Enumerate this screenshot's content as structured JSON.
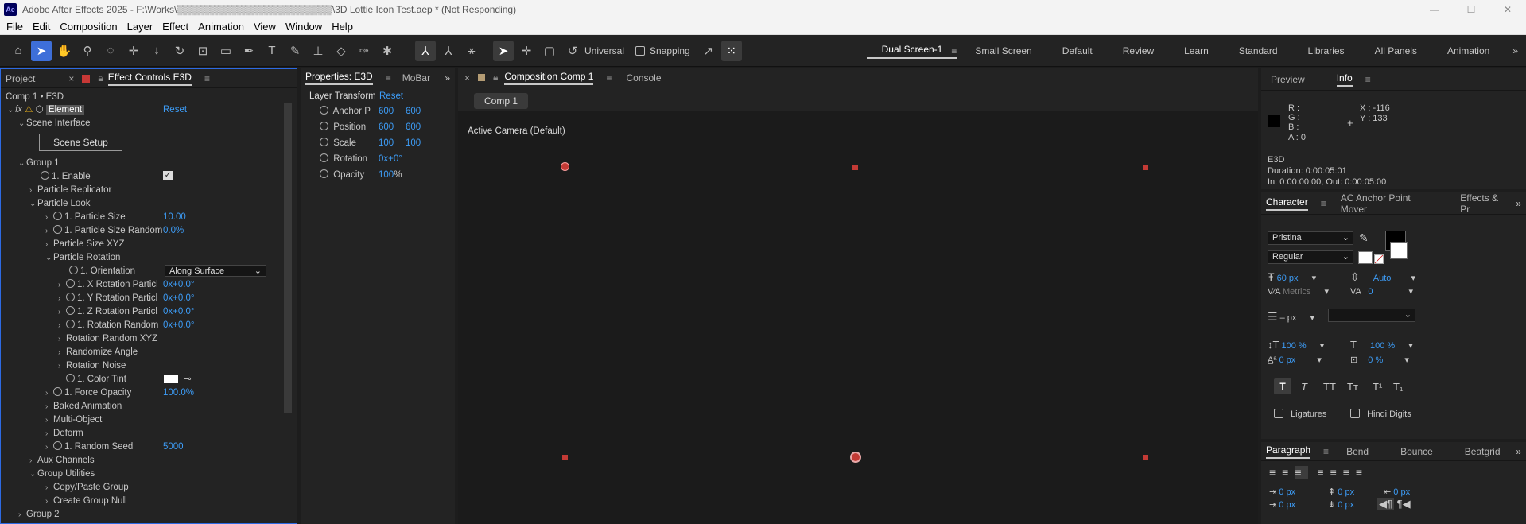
{
  "window": {
    "title": "Adobe After Effects 2025 - F:\\Works\\▒▒▒▒▒▒▒▒▒▒▒▒▒▒▒▒▒▒▒▒▒▒▒\\3D Lottie Icon Test.aep * (Not Responding)",
    "app_icon": "Ae"
  },
  "menu": [
    "File",
    "Edit",
    "Composition",
    "Layer",
    "Effect",
    "Animation",
    "View",
    "Window",
    "Help"
  ],
  "toolbar": {
    "universal": "Universal",
    "snapping": "Snapping"
  },
  "workspaces": [
    "Dual Screen-1",
    "Small Screen",
    "Default",
    "Review",
    "Learn",
    "Standard",
    "Libraries",
    "All Panels",
    "Animation"
  ],
  "left_panel": {
    "tab_project": "Project",
    "tab_effects": "Effect Controls E3D",
    "header": "Comp 1 • E3D",
    "fx": "fx",
    "element": "Element",
    "reset": "Reset",
    "scene_interface": "Scene Interface",
    "scene_setup": "Scene Setup",
    "group1": "Group 1",
    "enable": "1. Enable",
    "particle_replicator": "Particle Replicator",
    "particle_look": "Particle Look",
    "particle_size": "1. Particle Size",
    "particle_size_val": "10.00",
    "particle_size_random": "1. Particle Size Random",
    "particle_size_random_val": "0.0%",
    "particle_size_xyz": "Particle Size XYZ",
    "particle_rotation": "Particle Rotation",
    "orientation": "1. Orientation",
    "orientation_val": "Along Surface",
    "x_rot": "1. X Rotation Particl",
    "y_rot": "1. Y Rotation Particl",
    "z_rot": "1. Z Rotation Particl",
    "rot_random": "1. Rotation Random",
    "rot_val": "0x+0.0°",
    "rot_random_xyz": "Rotation Random XYZ",
    "randomize_angle": "Randomize Angle",
    "rotation_noise": "Rotation Noise",
    "color_tint": "1. Color Tint",
    "force_opacity": "1. Force Opacity",
    "force_opacity_val": "100.0%",
    "baked_animation": "Baked Animation",
    "multi_object": "Multi-Object",
    "deform": "Deform",
    "random_seed": "1. Random Seed",
    "random_seed_val": "5000",
    "aux_channels": "Aux Channels",
    "group_utilities": "Group Utilities",
    "copy_paste_group": "Copy/Paste Group",
    "create_group_null": "Create Group Null",
    "group2": "Group 2"
  },
  "props_panel": {
    "tab_props": "Properties: E3D",
    "tab_mobar": "MoBar",
    "layer_transform": "Layer Transform",
    "reset": "Reset",
    "anchor": "Anchor P",
    "anchor_v1": "600",
    "anchor_v2": "600",
    "position": "Position",
    "position_v1": "600",
    "position_v2": "600",
    "scale": "Scale",
    "scale_v1": "100",
    "scale_v2": "100",
    "rotation": "Rotation",
    "rotation_v": "0x+0°",
    "opacity": "Opacity",
    "opacity_v": "100",
    "opacity_unit": "%"
  },
  "comp_panel": {
    "tab_comp": "Composition Comp 1",
    "tab_console": "Console",
    "comp_button": "Comp 1",
    "camera": "Active Camera (Default)"
  },
  "info_panel": {
    "tab_preview": "Preview",
    "tab_info": "Info",
    "r": "R :",
    "g": "G :",
    "b": "B :",
    "a": "A :  0",
    "x": "X : -116",
    "y": "Y : 133",
    "layer": "E3D",
    "duration": "Duration: 0:00:05:01",
    "in_out": "In: 0:00:00:00, Out: 0:00:05:00"
  },
  "character_panel": {
    "tab_character": "Character",
    "tab_anchor": "AC Anchor Point Mover",
    "tab_effects": "Effects & Pr",
    "font": "Pristina",
    "style": "Regular",
    "size": "60 px",
    "leading": "Auto",
    "kerning": "Metrics",
    "tracking": "0",
    "stroke": "– px",
    "vscale": "100 %",
    "hscale": "100 %",
    "baseline": "0 px",
    "tsume": "0 %",
    "ligatures": "Ligatures",
    "hindi": "Hindi Digits"
  },
  "paragraph_panel": {
    "tab_paragraph": "Paragraph",
    "tab_bend": "Bend",
    "tab_bounce": "Bounce",
    "tab_beatgrid": "Beatgrid",
    "v1": "0 px",
    "v2": "0 px",
    "v3": "0 px",
    "v4": "0 px",
    "v5": "0 px"
  }
}
